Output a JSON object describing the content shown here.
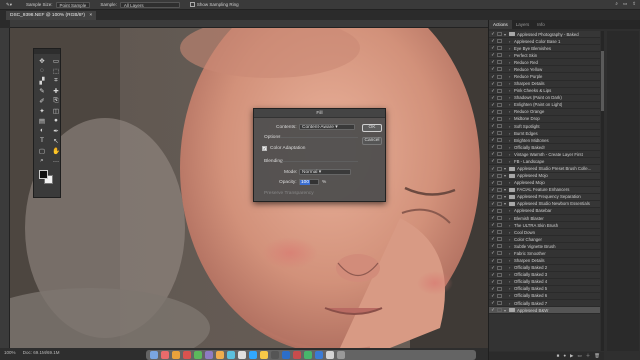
{
  "options_bar": {
    "sample_size_label": "Sample Size:",
    "sample_size_value": "Point Sample",
    "sample_label": "Sample:",
    "sample_value": "All Layers",
    "show_ring_label": "Show Sampling Ring"
  },
  "document": {
    "tab_title": "DSC_9398.NEF @ 100% (RGB/8*)",
    "zoom": "100%",
    "doc_size": "Doc: 69.1M/69.1M"
  },
  "tools": [
    {
      "left": "move-icon",
      "right": "artboard-icon"
    },
    {
      "left": "marquee-icon",
      "right": "lasso-icon"
    },
    {
      "left": "quick-select-icon",
      "right": "crop-icon"
    },
    {
      "left": "eyedropper-icon",
      "right": "spot-healing-icon"
    },
    {
      "left": "brush-icon",
      "right": "clone-stamp-icon"
    },
    {
      "left": "history-brush-icon",
      "right": "eraser-icon"
    },
    {
      "left": "gradient-icon",
      "right": "blur-icon"
    },
    {
      "left": "dodge-icon",
      "right": "pen-icon"
    },
    {
      "left": "type-icon",
      "right": "path-select-icon"
    },
    {
      "left": "rectangle-icon",
      "right": "hand-icon"
    },
    {
      "left": "zoom-icon",
      "right": "more-tools-icon"
    }
  ],
  "tool_glyphs": [
    "✥",
    "▭",
    "◌",
    "⬚",
    "▞",
    "⌗",
    "✎",
    "✚",
    "✐",
    "⎘",
    "✦",
    "◫",
    "▤",
    "●",
    "◐",
    "✒",
    "T",
    "↖",
    "▢",
    "✋",
    "⌕",
    "…"
  ],
  "fill_dialog": {
    "title": "Fill",
    "contents_label": "Contents:",
    "contents_value": "Content-Aware",
    "ok": "OK",
    "cancel": "Cancel",
    "options_label": "Options",
    "color_adaptation_label": "Color Adaptation",
    "color_adaptation_checked": true,
    "blending_label": "Blending",
    "mode_label": "Mode:",
    "mode_value": "Normal",
    "opacity_label": "Opacity:",
    "opacity_value": "100",
    "opacity_unit": "%",
    "preserve_label": "Preserve Transparency"
  },
  "actions_panel": {
    "tabs": [
      "Actions",
      "Layers",
      "Info"
    ],
    "rows": [
      {
        "label": "Applessed Photography - Baked",
        "kind": "group"
      },
      {
        "label": "Appleseed Color Base 1",
        "kind": "item"
      },
      {
        "label": "Eye Bye Blemishes",
        "kind": "item"
      },
      {
        "label": "Perfect Skin",
        "kind": "item"
      },
      {
        "label": "Reduce Red",
        "kind": "item"
      },
      {
        "label": "Reduce Yellow",
        "kind": "item"
      },
      {
        "label": "Reduce Purple",
        "kind": "item"
      },
      {
        "label": "Sharpen Details",
        "kind": "item"
      },
      {
        "label": "Pink Cheeks & Lips",
        "kind": "item"
      },
      {
        "label": "Shadows (Paint on Dark)",
        "kind": "item"
      },
      {
        "label": "Enlighten (Paint on Light)",
        "kind": "item"
      },
      {
        "label": "Reduce Orange",
        "kind": "item"
      },
      {
        "label": "Midtone Drop",
        "kind": "item"
      },
      {
        "label": "Soft Spotlight",
        "kind": "item"
      },
      {
        "label": "Burnt Edges",
        "kind": "item"
      },
      {
        "label": "Brighten Midtones",
        "kind": "item"
      },
      {
        "label": "Officially Baked!",
        "kind": "item"
      },
      {
        "label": "Vintage Warmth - Create Layer First",
        "kind": "item"
      },
      {
        "label": "FB - Landscape",
        "kind": "item"
      },
      {
        "label": "Appleseed Studio Preset Brush Colle...",
        "kind": "group"
      },
      {
        "label": "Appleseed Mojo",
        "kind": "group"
      },
      {
        "label": "Appleseed Mojo",
        "kind": "item"
      },
      {
        "label": "FACIAL Feature Enhancers",
        "kind": "group"
      },
      {
        "label": "Appleseed Frequency Separation",
        "kind": "group"
      },
      {
        "label": "Appleseed Studio Newborn Essentials",
        "kind": "group"
      },
      {
        "label": "Appleseed Basebar",
        "kind": "item"
      },
      {
        "label": "Blemish Blaster",
        "kind": "item"
      },
      {
        "label": "The ULTRA Skin Brush",
        "kind": "item"
      },
      {
        "label": "Cool Down",
        "kind": "item"
      },
      {
        "label": "Color Changer",
        "kind": "item"
      },
      {
        "label": "Subtle Vignette Brush",
        "kind": "item"
      },
      {
        "label": "Fabric Smoother",
        "kind": "item"
      },
      {
        "label": "Sharpen Details",
        "kind": "item"
      },
      {
        "label": "Officially Baked 2",
        "kind": "item"
      },
      {
        "label": "Officially Baked 3",
        "kind": "item"
      },
      {
        "label": "Officially Baked 4",
        "kind": "item"
      },
      {
        "label": "Officially Baked 5",
        "kind": "item"
      },
      {
        "label": "Officially Baked 6",
        "kind": "item"
      },
      {
        "label": "Officially Baked 7",
        "kind": "item"
      },
      {
        "label": "Appleseed B&W",
        "kind": "group"
      }
    ]
  }
}
